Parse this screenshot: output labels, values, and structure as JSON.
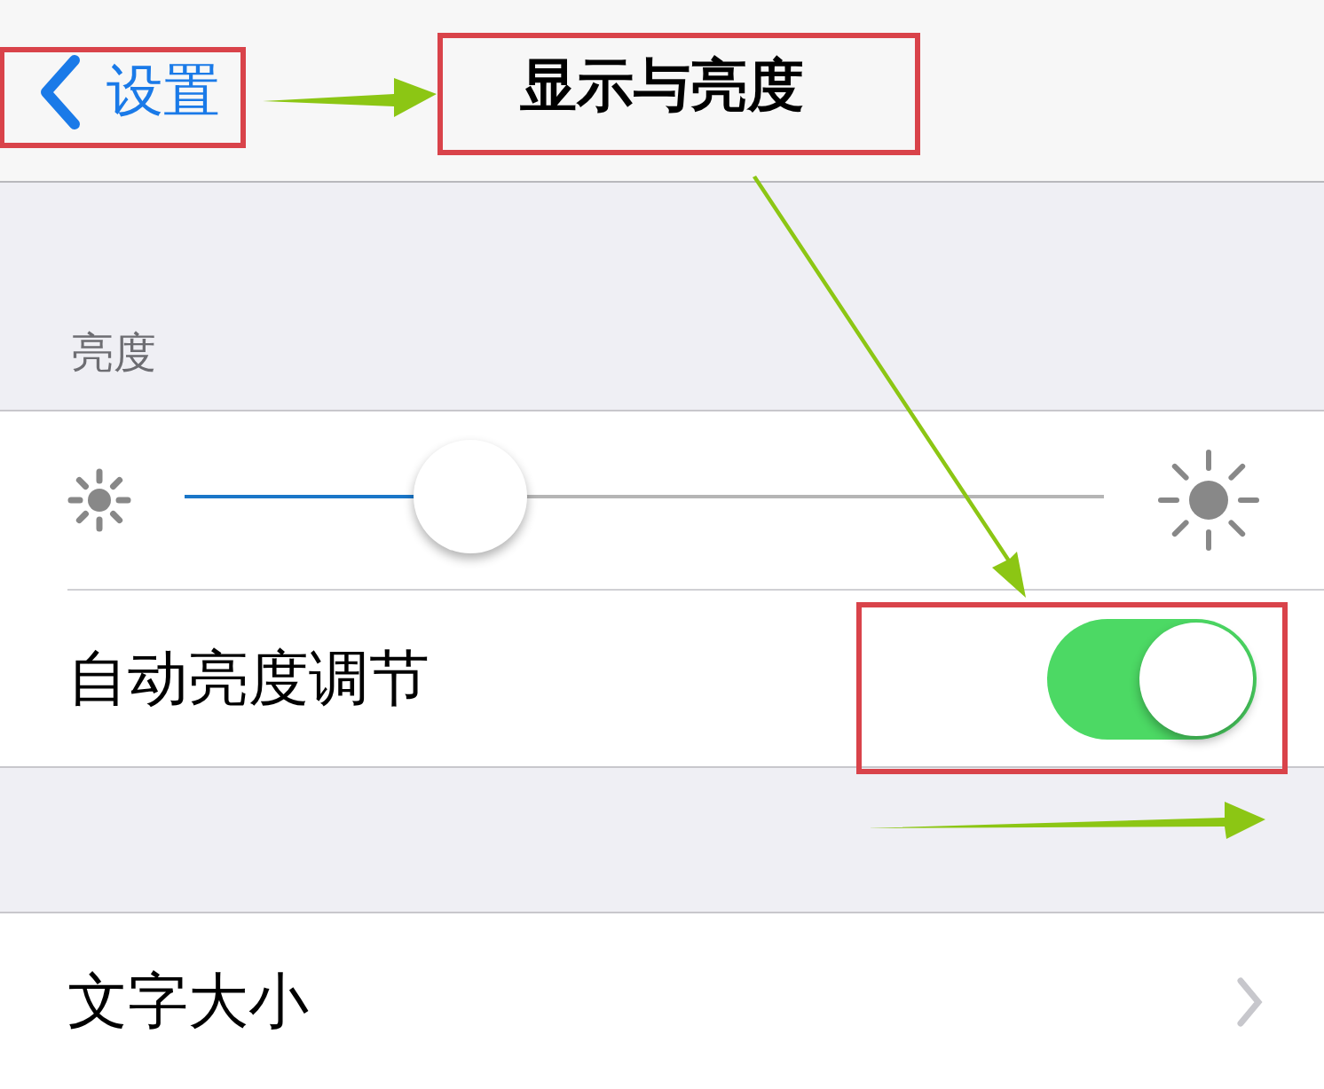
{
  "nav_bar": {
    "back_label": "设置",
    "title": "显示与亮度"
  },
  "sections": [
    {
      "header": "亮度",
      "rows": [
        {
          "kind": "slider",
          "level": 0.31
        },
        {
          "kind": "toggle",
          "label": "自动亮度调节",
          "on": true
        }
      ]
    },
    {
      "rows": [
        {
          "kind": "link",
          "label": "文字大小"
        }
      ]
    }
  ]
}
